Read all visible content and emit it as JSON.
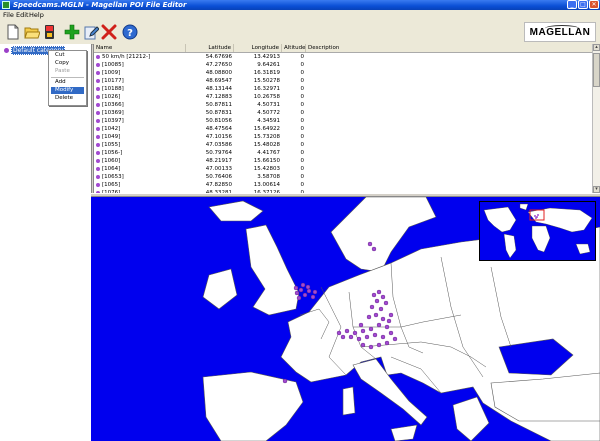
{
  "window": {
    "title": "Speedcams.MGLN - Magellan POI File Editor",
    "minimize": "_",
    "maximize": "□",
    "close": "✕"
  },
  "menu": [
    "File",
    "Edit",
    "Help"
  ],
  "toolbar": {
    "icons": [
      "new-file-icon",
      "open-folder-icon",
      "save-disk-icon",
      "add-plus-icon",
      "edit-note-icon",
      "delete-x-icon",
      "help-icon"
    ],
    "logo_text": "MAGELLAN"
  },
  "tree": {
    "root_label": "Default category"
  },
  "context_menu": {
    "items": [
      "Cut",
      "Copy",
      "Paste",
      "Add",
      "Modify",
      "Delete"
    ],
    "disabled": [
      "Paste"
    ],
    "selected": "Modify"
  },
  "table": {
    "columns": [
      "Name",
      "Latitude",
      "Longitude",
      "Altitude",
      "Description"
    ],
    "rows": [
      [
        "50 km/h [21212-]",
        "54.67696",
        "13.42913",
        "0",
        ""
      ],
      [
        "[10085]",
        "47.27650",
        "9.64261",
        "0",
        ""
      ],
      [
        "[1009]",
        "48.08800",
        "16.31819",
        "0",
        ""
      ],
      [
        "[10177]",
        "48.69547",
        "15.50278",
        "0",
        ""
      ],
      [
        "[10188]",
        "48.13144",
        "16.32971",
        "0",
        ""
      ],
      [
        "[1026]",
        "47.12883",
        "10.26758",
        "0",
        ""
      ],
      [
        "[10366]",
        "50.87811",
        "4.50731",
        "0",
        ""
      ],
      [
        "[10369]",
        "50.87831",
        "4.50772",
        "0",
        ""
      ],
      [
        "[10397]",
        "50.81056",
        "4.34591",
        "0",
        ""
      ],
      [
        "[1042]",
        "48.47564",
        "15.64922",
        "0",
        ""
      ],
      [
        "[1049]",
        "47.10156",
        "15.73208",
        "0",
        ""
      ],
      [
        "[1055]",
        "47.03586",
        "15.48028",
        "0",
        ""
      ],
      [
        "[1056-]",
        "50.79764",
        "4.41767",
        "0",
        ""
      ],
      [
        "[1060]",
        "48.21917",
        "15.66150",
        "0",
        ""
      ],
      [
        "[1064]",
        "47.00133",
        "15.42803",
        "0",
        ""
      ],
      [
        "[10653]",
        "50.76406",
        "3.58708",
        "0",
        ""
      ],
      [
        "[1065]",
        "47.82850",
        "13.00614",
        "0",
        ""
      ],
      [
        "[1076]",
        "48.33281",
        "16.37126",
        "0",
        ""
      ]
    ]
  },
  "colors": {
    "sea": "#0000ee",
    "land": "#ffffff",
    "poi": "#a24ad0",
    "selection": "#316ac5"
  }
}
